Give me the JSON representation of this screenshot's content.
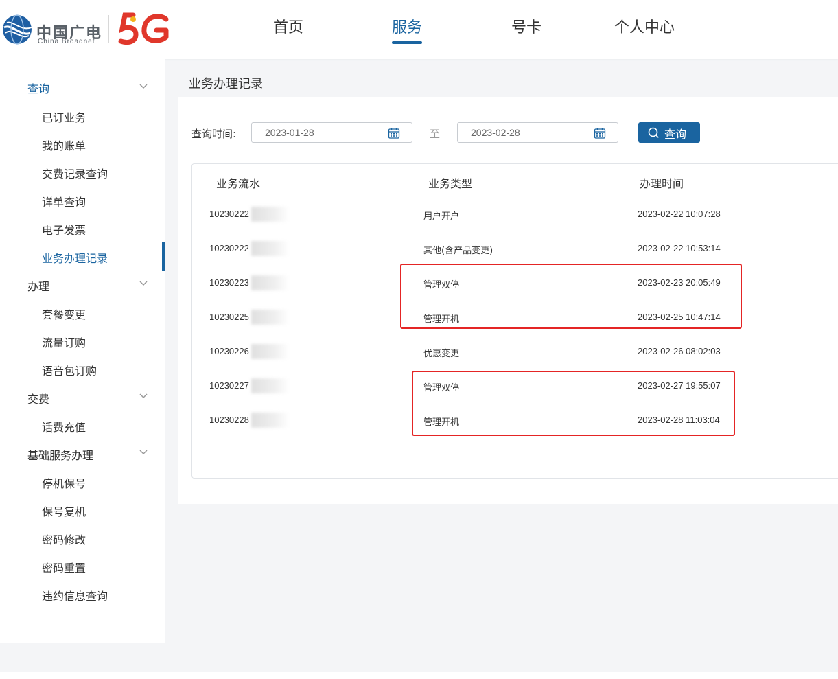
{
  "header": {
    "logo_cn": "中国广电",
    "logo_en": "China Broadnet",
    "nav": [
      {
        "label": "首页",
        "active": false
      },
      {
        "label": "服务",
        "active": true
      },
      {
        "label": "号卡",
        "active": false
      },
      {
        "label": "个人中心",
        "active": false
      }
    ]
  },
  "sidebar": {
    "groups": [
      {
        "label": "查询",
        "active": true,
        "items": [
          "已订业务",
          "我的账单",
          "交费记录查询",
          "详单查询",
          "电子发票",
          "业务办理记录"
        ]
      },
      {
        "label": "办理",
        "active": false,
        "items": [
          "套餐变更",
          "流量订购",
          "语音包订购"
        ]
      },
      {
        "label": "交费",
        "active": false,
        "items": [
          "话费充值"
        ]
      },
      {
        "label": "基础服务办理",
        "active": false,
        "items": [
          "停机保号",
          "保号复机",
          "密码修改",
          "密码重置",
          "违约信息查询"
        ]
      }
    ],
    "active_item": "业务办理记录"
  },
  "main": {
    "title": "业务办理记录",
    "filter": {
      "label": "查询时间:",
      "start_date": "2023-01-28",
      "separator": "至",
      "end_date": "2023-02-28",
      "search_label": "查询"
    },
    "table": {
      "columns": [
        "业务流水",
        "业务类型",
        "办理时间"
      ],
      "rows": [
        {
          "serial": "10230222",
          "type": "用户开户",
          "time": "2023-02-22 10:07:28"
        },
        {
          "serial": "10230222",
          "type": "其他(含产品变更)",
          "time": "2023-02-22 10:53:14"
        },
        {
          "serial": "10230223",
          "type": "管理双停",
          "time": "2023-02-23 20:05:49"
        },
        {
          "serial": "10230225",
          "type": "管理开机",
          "time": "2023-02-25 10:47:14"
        },
        {
          "serial": "10230226",
          "type": "优惠变更",
          "time": "2023-02-26 08:02:03"
        },
        {
          "serial": "10230227",
          "type": "管理双停",
          "time": "2023-02-27 19:55:07"
        },
        {
          "serial": "10230228",
          "type": "管理开机",
          "time": "2023-02-28 11:03:04"
        }
      ]
    }
  },
  "colors": {
    "accent": "#1a64a0",
    "highlight": "#e42525",
    "brand_red": "#e0372b",
    "brand_yellow": "#f5b21b"
  }
}
